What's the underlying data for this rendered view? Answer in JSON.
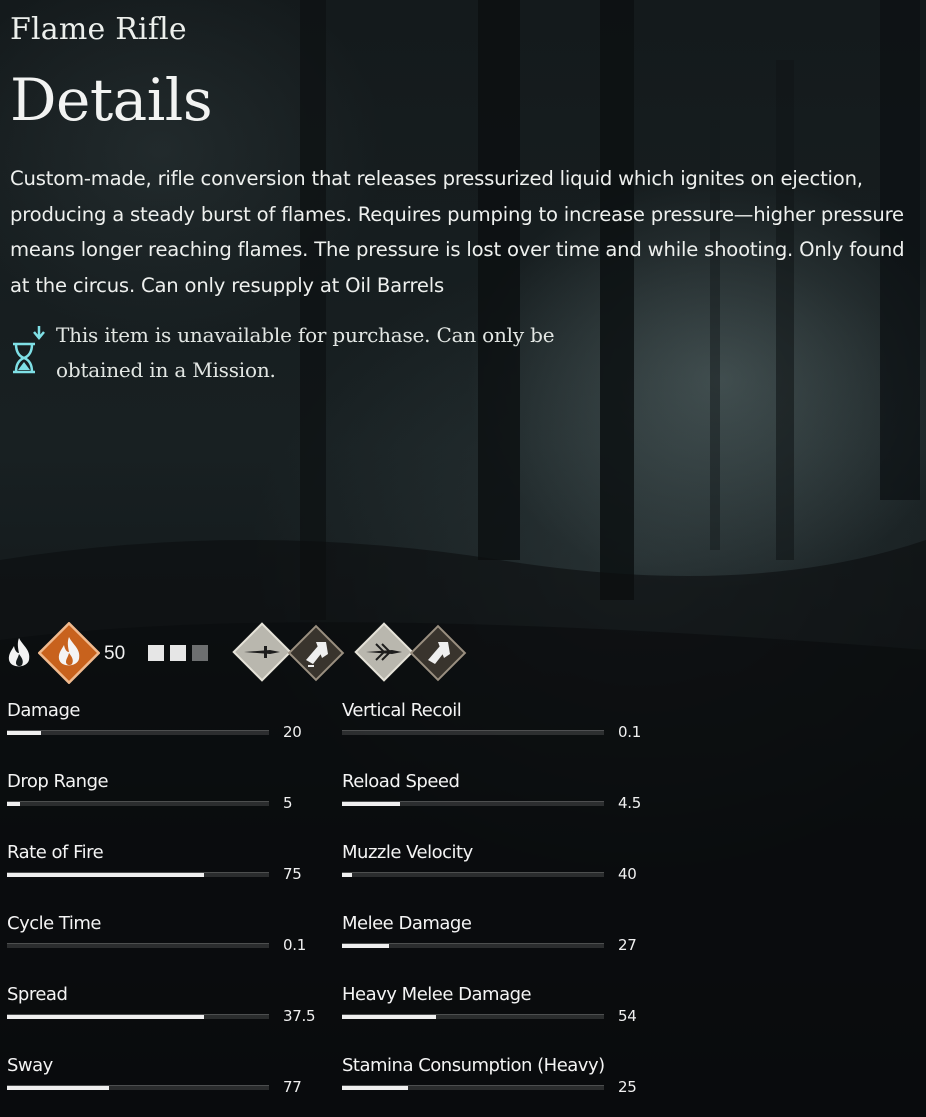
{
  "item": {
    "title": "Flame Rifle",
    "section_heading": "Details"
  },
  "description": "Custom-made, rifle conversion that releases pressurized liquid which ignites on ejection, producing a steady burst of flames. Requires pumping to increase pressure—higher pressure means longer reaching flames. The pressure is lost over time and while shooting.  Only found at the circus.  Can only resupply at Oil Barrels",
  "notice": {
    "icon": "hourglass-icon",
    "text": "This item is unavailable for purchase. Can only be obtained in a Mission."
  },
  "ammo": {
    "count": "50"
  },
  "icons": [
    "fire-ammo-icon",
    "incendiary-ammo-badge-icon",
    "ammo-slots-icon",
    "melee-stab-icon",
    "heavy-melee-icon",
    "alt-melee-stab-icon",
    "alt-heavy-melee-icon"
  ],
  "colors": {
    "accent_orange": "#c8621d",
    "notice_cyan": "#7fe0e6",
    "text": "#eef0ee",
    "bar_fill": "#efefef"
  },
  "stats": {
    "left": [
      {
        "label": "Damage",
        "value": "20",
        "fill": 0.13
      },
      {
        "label": "Drop Range",
        "value": "5",
        "fill": 0.05
      },
      {
        "label": "Rate of Fire",
        "value": "75",
        "fill": 0.75
      },
      {
        "label": "Cycle Time",
        "value": "0.1",
        "fill": 0.0
      },
      {
        "label": "Spread",
        "value": "37.5",
        "fill": 0.75
      },
      {
        "label": "Sway",
        "value": "77",
        "fill": 0.39
      }
    ],
    "right": [
      {
        "label": "Vertical Recoil",
        "value": "0.1",
        "fill": 0.0
      },
      {
        "label": "Reload Speed",
        "value": "4.5",
        "fill": 0.22
      },
      {
        "label": "Muzzle Velocity",
        "value": "40",
        "fill": 0.04
      },
      {
        "label": "Melee Damage",
        "value": "27",
        "fill": 0.18
      },
      {
        "label": "Heavy Melee Damage",
        "value": "54",
        "fill": 0.36
      },
      {
        "label": "Stamina Consumption (Heavy)",
        "value": "25",
        "fill": 0.25
      }
    ]
  }
}
